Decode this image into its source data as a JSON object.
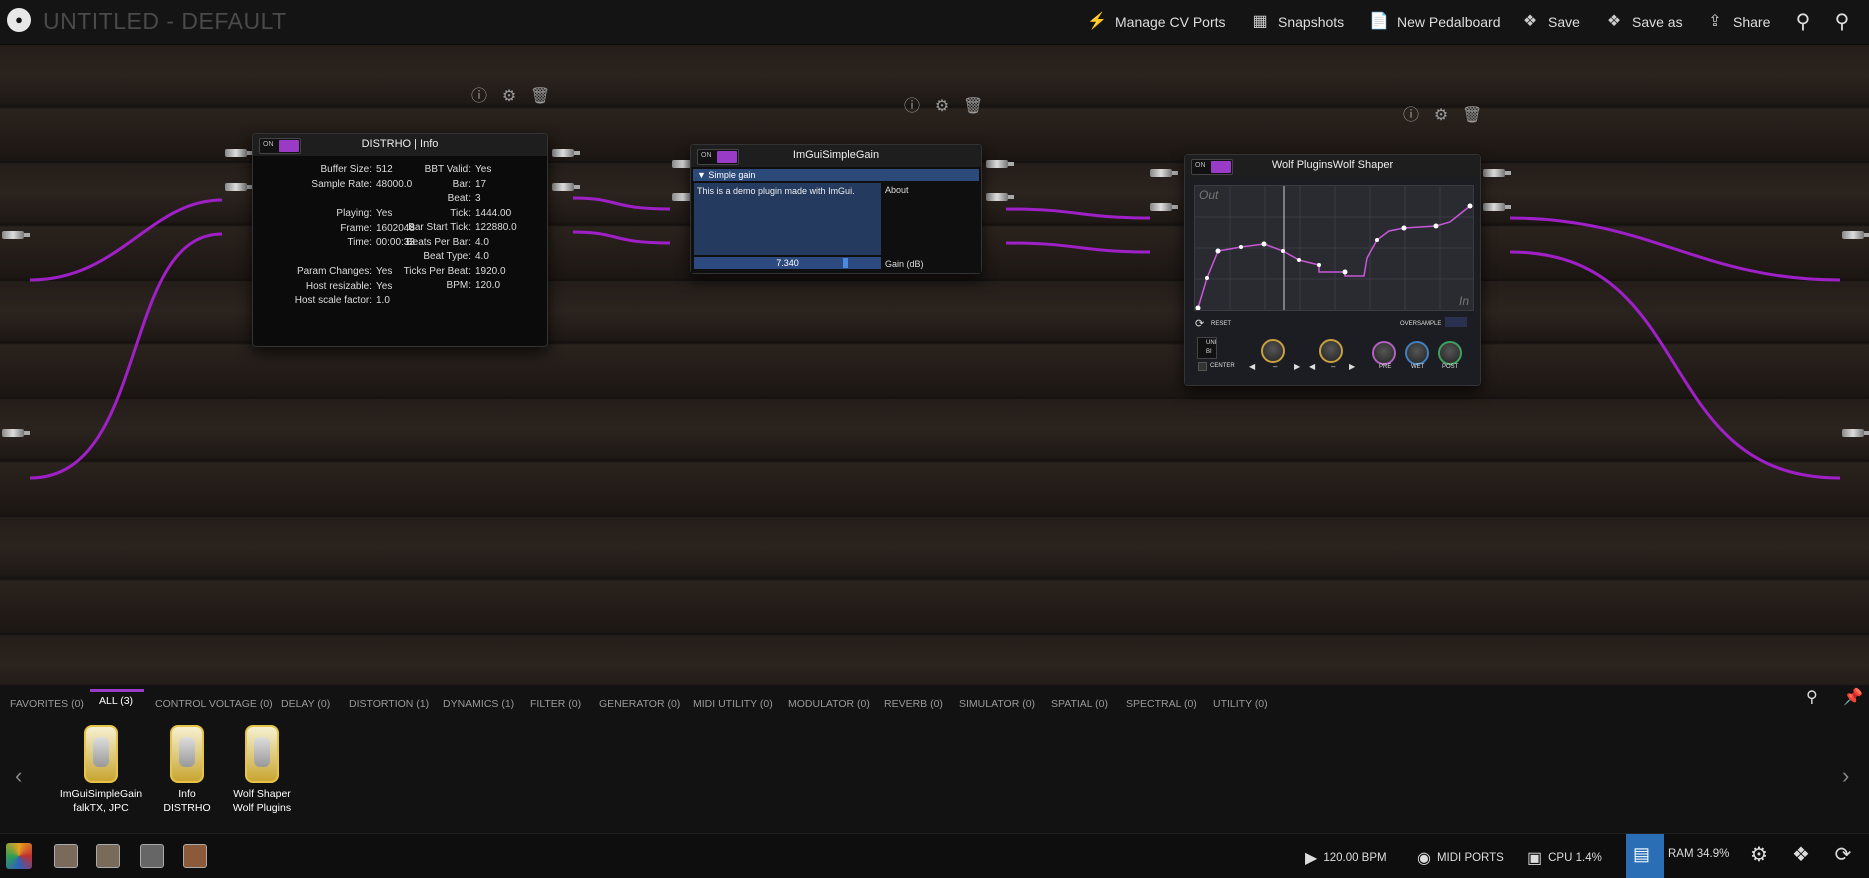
{
  "topbar": {
    "logo": "●",
    "title": "UNTITLED - DEFAULT",
    "buttons": {
      "manage_cv": "Manage CV Ports",
      "snapshots": "Snapshots",
      "new_pedalboard": "New Pedalboard",
      "save": "Save",
      "save_as": "Save as",
      "share": "Share"
    }
  },
  "plugins": {
    "info": {
      "title": "DISTRHO | Info",
      "on_label": "ON",
      "left": [
        {
          "k": "Buffer Size:",
          "v": "512"
        },
        {
          "k": "Sample Rate:",
          "v": "48000.0"
        },
        {
          "k": "Playing:",
          "v": "Yes"
        },
        {
          "k": "Frame:",
          "v": "1602048"
        },
        {
          "k": "Time:",
          "v": "00:00:33"
        },
        {
          "k": "Param Changes:",
          "v": "Yes"
        },
        {
          "k": "Host resizable:",
          "v": "Yes"
        },
        {
          "k": "Host scale factor:",
          "v": "1.0"
        }
      ],
      "right": [
        {
          "k": "BBT Valid:",
          "v": "Yes"
        },
        {
          "k": "Bar:",
          "v": "17"
        },
        {
          "k": "Beat:",
          "v": "3"
        },
        {
          "k": "Tick:",
          "v": "1444.00"
        },
        {
          "k": "Bar Start Tick:",
          "v": "122880.0"
        },
        {
          "k": "Beats Per Bar:",
          "v": "4.0"
        },
        {
          "k": "Beat Type:",
          "v": "4.0"
        },
        {
          "k": "Ticks Per Beat:",
          "v": "1920.0"
        },
        {
          "k": "BPM:",
          "v": "120.0"
        }
      ]
    },
    "gain": {
      "title": "ImGuiSimpleGain",
      "on_label": "ON",
      "section": "▼ Simple gain",
      "text": "This is a demo plugin made with ImGui.",
      "about": "About",
      "value": "7.340",
      "value_fraction": 0.82,
      "param": "Gain (dB)"
    },
    "shaper": {
      "title": "Wolf PluginsWolf Shaper",
      "on_label": "ON",
      "out_label": "Out",
      "in_label": "In",
      "reset": "RESET",
      "oversample": "OVERSAMPLE",
      "bipolar_top": "UNI",
      "bipolar_bottom": "BI",
      "center": "CENTER",
      "pre": "PRE",
      "wet": "WET",
      "post": "POST",
      "dash": "–"
    }
  },
  "browser": {
    "tabs": [
      "FAVORITES (0)",
      "ALL (3)",
      "CONTROL VOLTAGE (0)",
      "DELAY (0)",
      "DISTORTION (1)",
      "DYNAMICS (1)",
      "FILTER (0)",
      "GENERATOR (0)",
      "MIDI UTILITY (0)",
      "MODULATOR (0)",
      "REVERB (0)",
      "SIMULATOR (0)",
      "SPATIAL (0)",
      "SPECTRAL (0)",
      "UTILITY (0)"
    ],
    "active_tab": "ALL (3)",
    "plugins": [
      {
        "name": "ImGuiSimpleGain",
        "brand": "falkTX, JPC"
      },
      {
        "name": "Info",
        "brand": "DISTRHO"
      },
      {
        "name": "Wolf Shaper",
        "brand": "Wolf Plugins"
      }
    ]
  },
  "status": {
    "bpm": "120.00 BPM",
    "midi": "MIDI PORTS",
    "cpu": "CPU 1.4%",
    "ram": "RAM 34.9%"
  },
  "colors": {
    "accent": "#9a3bc8",
    "cable": "#a020c8",
    "ram_bg": "#2a6fb5"
  }
}
